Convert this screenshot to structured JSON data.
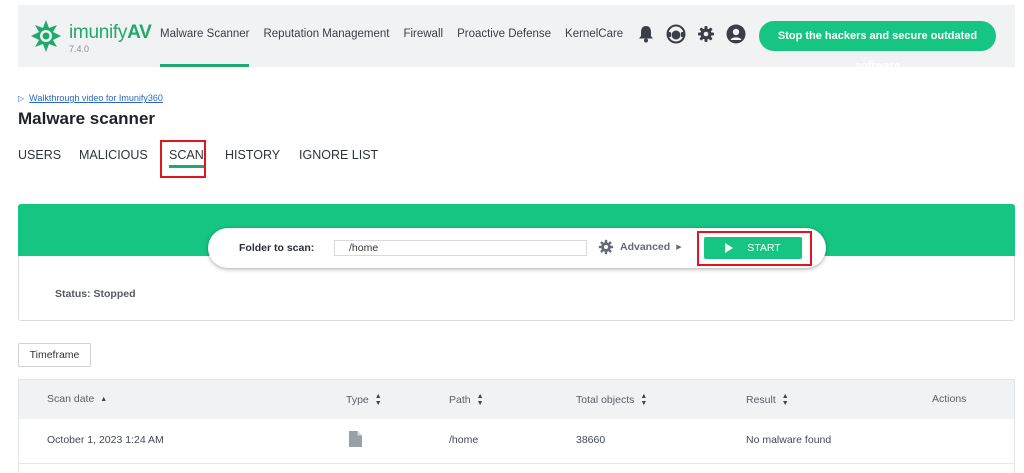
{
  "header": {
    "brand_name": "imunify",
    "brand_suffix": "AV",
    "version": "7.4.0",
    "nav": [
      {
        "label": "Malware Scanner",
        "active": true
      },
      {
        "label": "Reputation Management",
        "active": false
      },
      {
        "label": "Firewall",
        "active": false
      },
      {
        "label": "Proactive Defense",
        "active": false
      },
      {
        "label": "KernelCare",
        "active": false
      }
    ],
    "icons": [
      "bell-icon",
      "support-agent-icon",
      "gear-icon",
      "user-icon"
    ],
    "cta_label": "Stop the hackers and secure outdated software"
  },
  "page": {
    "walkthrough_link": "Walkthrough video for Imunify360",
    "title": "Malware scanner"
  },
  "tabs": [
    {
      "label": "USERS",
      "active": false
    },
    {
      "label": "MALICIOUS",
      "active": false
    },
    {
      "label": "SCAN",
      "active": true
    },
    {
      "label": "HISTORY",
      "active": false
    },
    {
      "label": "IGNORE LIST",
      "active": false
    }
  ],
  "scan": {
    "folder_label": "Folder to scan:",
    "folder_value": "/home",
    "advanced_label": "Advanced",
    "start_label": "START",
    "status": "Status: Stopped"
  },
  "filters": {
    "timeframe_label": "Timeframe"
  },
  "table": {
    "columns": [
      {
        "label": "Scan date",
        "sort": "asc"
      },
      {
        "label": "Type",
        "sort": "both"
      },
      {
        "label": "Path",
        "sort": "both"
      },
      {
        "label": "Total objects",
        "sort": "both"
      },
      {
        "label": "Result",
        "sort": "both"
      },
      {
        "label": "Actions",
        "sort": "none"
      }
    ],
    "rows": [
      {
        "scan_date": "October 1, 2023 1:24 AM",
        "type_icon": "file-icon",
        "path": "/home",
        "total_objects": "38660",
        "result": "No malware found"
      }
    ]
  },
  "colors": {
    "brand_green": "#20a96c",
    "accent_green": "#17c583",
    "highlight_red": "#e2141f"
  }
}
